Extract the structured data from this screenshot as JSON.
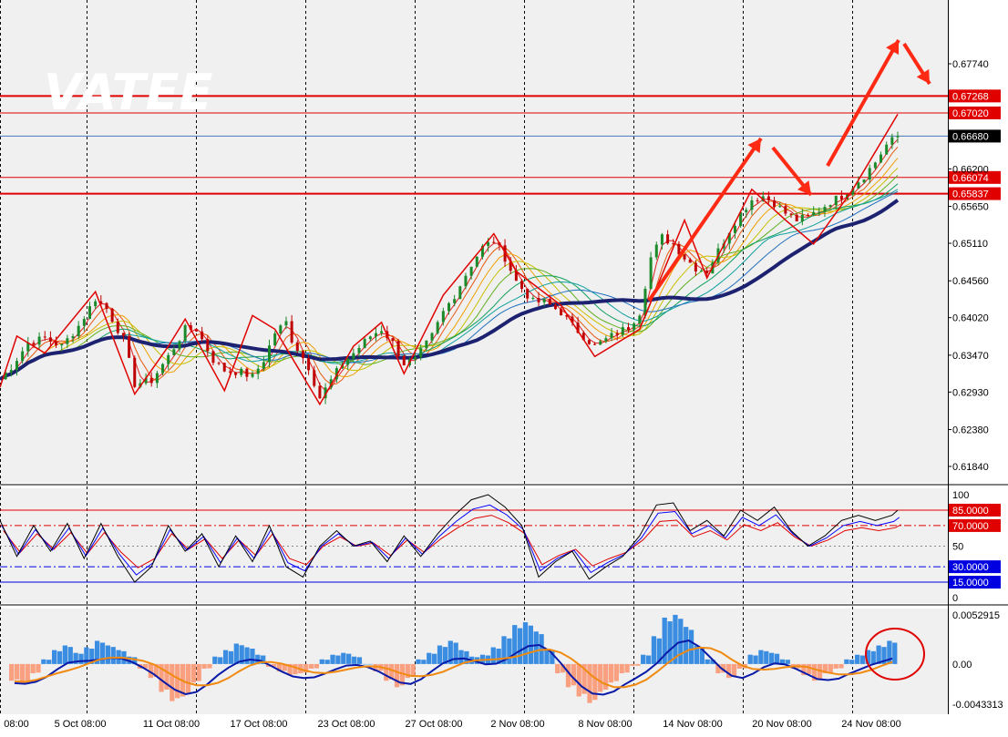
{
  "watermark": "VATEE",
  "colors": {
    "background": "#ffffff",
    "panel": "#f0f0f0",
    "grid": "#000000",
    "bull_candle": "#1a8a2a",
    "bear_candle": "#c00000",
    "level_line": "#e00000",
    "current_line": "#4a7ab8",
    "ma_slow": "#1c2270",
    "zigzag": "#e00000",
    "arrow": "#ff2a14",
    "stoch_k": "#000000",
    "stoch_d": "#0000ff",
    "stoch_slow": "#e00000",
    "macd_pos": "#3a8de0",
    "macd_neg": "#f8a080",
    "macd_line": "#0a1aa8",
    "signal_line": "#f08a10",
    "highlight_circle": "#e00000"
  },
  "time_axis": {
    "labels": [
      "08:00",
      "5 Oct 08:00",
      "11 Oct 08:00",
      "17 Oct 08:00",
      "23 Oct 08:00",
      "27 Oct 08:00",
      "2 Nov 08:00",
      "8 Nov 08:00",
      "14 Nov 08:00",
      "20 Nov 08:00",
      "24 Nov 08:00"
    ]
  },
  "price_axis": {
    "ticks": [
      "0.67740",
      "0.66200",
      "0.65650",
      "0.65110",
      "0.64560",
      "0.64020",
      "0.63470",
      "0.62930",
      "0.62380",
      "0.61840"
    ],
    "levels": [
      {
        "label": "0.67268",
        "value": 0.67268,
        "style": "red-tag"
      },
      {
        "label": "0.67020",
        "value": 0.6702,
        "style": "red-tag"
      },
      {
        "label": "0.66680",
        "value": 0.6668,
        "style": "current"
      },
      {
        "label": "0.66074",
        "value": 0.66074,
        "style": "red-tag"
      },
      {
        "label": "0.65837",
        "value": 0.65837,
        "style": "red-tag"
      }
    ]
  },
  "oscillator_axis": {
    "ticks": [
      "100",
      "50",
      "0"
    ],
    "levels": [
      {
        "label": "85.0000",
        "value": 85,
        "color": "#e00000",
        "tag_text": "#ffffff"
      },
      {
        "label": "70.0000",
        "value": 70,
        "color": "#e00000",
        "tag_text": "#ffffff"
      },
      {
        "label": "30.0000",
        "value": 30,
        "color": "#0000e0",
        "tag_text": "#ffffff"
      },
      {
        "label": "15.0000",
        "value": 15,
        "color": "#0000e0",
        "tag_text": "#ffffff"
      }
    ]
  },
  "macd_axis": {
    "ticks": [
      "0.0052915",
      "0.00",
      "-0.0043313"
    ]
  },
  "chart_data": [
    {
      "type": "candlestick",
      "title": "",
      "x": [
        "08:00",
        "5 Oct 08:00",
        "11 Oct 08:00",
        "17 Oct 08:00",
        "23 Oct 08:00",
        "27 Oct 08:00",
        "2 Nov 08:00",
        "8 Nov 08:00",
        "14 Nov 08:00",
        "20 Nov 08:00",
        "24 Nov 08:00"
      ],
      "close_path": [
        [
          0,
          0.6312
        ],
        [
          2,
          0.633
        ],
        [
          5,
          0.6365
        ],
        [
          8,
          0.6372
        ],
        [
          11,
          0.636
        ],
        [
          14,
          0.639
        ],
        [
          17,
          0.643
        ],
        [
          19,
          0.6415
        ],
        [
          22,
          0.637
        ],
        [
          24,
          0.6305
        ],
        [
          27,
          0.631
        ],
        [
          30,
          0.6345
        ],
        [
          33,
          0.6385
        ],
        [
          35,
          0.6385
        ],
        [
          38,
          0.634
        ],
        [
          40,
          0.6325
        ],
        [
          43,
          0.6322
        ],
        [
          45,
          0.6315
        ],
        [
          47,
          0.634
        ],
        [
          49,
          0.638
        ],
        [
          51,
          0.6395
        ],
        [
          52,
          0.637
        ],
        [
          55,
          0.633
        ],
        [
          57,
          0.6285
        ],
        [
          59,
          0.631
        ],
        [
          61,
          0.6335
        ],
        [
          63,
          0.635
        ],
        [
          66,
          0.6375
        ],
        [
          68,
          0.6385
        ],
        [
          70,
          0.6365
        ],
        [
          72,
          0.6335
        ],
        [
          74,
          0.634
        ],
        [
          77,
          0.6375
        ],
        [
          79,
          0.641
        ],
        [
          81,
          0.6435
        ],
        [
          84,
          0.648
        ],
        [
          86,
          0.6505
        ],
        [
          88,
          0.6515
        ],
        [
          90,
          0.649
        ],
        [
          92,
          0.6455
        ],
        [
          95,
          0.6425
        ],
        [
          97,
          0.6425
        ],
        [
          100,
          0.641
        ],
        [
          102,
          0.639
        ],
        [
          104,
          0.6375
        ],
        [
          106,
          0.636
        ],
        [
          108,
          0.637
        ],
        [
          110,
          0.638
        ],
        [
          112,
          0.6388
        ],
        [
          114,
          0.641
        ],
        [
          116,
          0.649
        ],
        [
          118,
          0.652
        ],
        [
          120,
          0.651
        ],
        [
          122,
          0.649
        ],
        [
          124,
          0.6475
        ],
        [
          126,
          0.647
        ],
        [
          128,
          0.65
        ],
        [
          130,
          0.653
        ],
        [
          132,
          0.6555
        ],
        [
          134,
          0.6575
        ],
        [
          136,
          0.658
        ],
        [
          138,
          0.657
        ],
        [
          140,
          0.6555
        ],
        [
          142,
          0.6545
        ],
        [
          144,
          0.655
        ],
        [
          146,
          0.656
        ],
        [
          148,
          0.6572
        ],
        [
          150,
          0.658
        ],
        [
          152,
          0.6595
        ],
        [
          154,
          0.661
        ],
        [
          156,
          0.663
        ],
        [
          158,
          0.6655
        ],
        [
          160,
          0.6668
        ]
      ],
      "overbought_level": 85,
      "oversold_level": 15
    },
    {
      "type": "line",
      "title": "",
      "series": [
        {
          "values": [
            [
              0,
              75
            ],
            [
              3,
              40
            ],
            [
              6,
              70
            ],
            [
              9,
              45
            ],
            [
              12,
              72
            ],
            [
              15,
              38
            ],
            [
              18,
              72
            ],
            [
              21,
              40
            ],
            [
              24,
              15
            ],
            [
              27,
              30
            ],
            [
              30,
              70
            ],
            [
              33,
              45
            ],
            [
              36,
              62
            ],
            [
              39,
              30
            ],
            [
              42,
              60
            ],
            [
              45,
              35
            ],
            [
              48,
              70
            ],
            [
              51,
              30
            ],
            [
              54,
              20
            ],
            [
              57,
              50
            ],
            [
              60,
              65
            ],
            [
              63,
              50
            ],
            [
              66,
              55
            ],
            [
              69,
              35
            ],
            [
              72,
              60
            ],
            [
              75,
              40
            ],
            [
              78,
              62
            ],
            [
              81,
              80
            ],
            [
              84,
              95
            ],
            [
              87,
              100
            ],
            [
              90,
              88
            ],
            [
              93,
              70
            ],
            [
              96,
              20
            ],
            [
              99,
              35
            ],
            [
              102,
              45
            ],
            [
              105,
              18
            ],
            [
              108,
              30
            ],
            [
              111,
              40
            ],
            [
              114,
              60
            ],
            [
              117,
              90
            ],
            [
              120,
              92
            ],
            [
              123,
              65
            ],
            [
              126,
              75
            ],
            [
              129,
              60
            ],
            [
              132,
              85
            ],
            [
              135,
              75
            ],
            [
              138,
              88
            ],
            [
              141,
              65
            ],
            [
              144,
              50
            ],
            [
              147,
              60
            ],
            [
              150,
              75
            ],
            [
              153,
              80
            ],
            [
              156,
              75
            ],
            [
              159,
              80
            ],
            [
              160,
              85
            ]
          ]
        }
      ]
    },
    {
      "type": "bar",
      "title": "",
      "series": [
        {
          "values": [
            -0.0018,
            -0.002,
            -0.001,
            0.0005,
            0.0015,
            0.002,
            0.0012,
            0.0018,
            0.0025,
            0.002,
            0.0015,
            0.0008,
            -0.0005,
            -0.0015,
            -0.003,
            -0.004,
            -0.0035,
            -0.002,
            -0.0005,
            0.0008,
            0.0015,
            0.0022,
            0.0018,
            0.001,
            -0.0003,
            -0.0008,
            -0.0012,
            -0.001,
            -0.0005,
            0.0005,
            0.001,
            0.0012,
            0.0008,
            0.0,
            -0.0008,
            -0.0018,
            -0.0025,
            -0.0015,
            0.0005,
            0.0012,
            0.002,
            0.0025,
            0.0015,
            0.0008,
            0.001,
            0.0018,
            0.003,
            0.0042,
            0.0045,
            0.0035,
            0.0015,
            -0.001,
            -0.0025,
            -0.0035,
            -0.0042,
            -0.003,
            -0.002,
            -0.001,
            -0.0002,
            0.001,
            0.003,
            0.005,
            0.0053,
            0.004,
            0.002,
            0.0005,
            -0.001,
            -0.0015,
            -0.0005,
            0.001,
            0.0015,
            0.0012,
            0.0005,
            -0.0005,
            -0.0012,
            -0.0018,
            -0.001,
            -0.0005,
            0.0005,
            0.001,
            0.0015,
            0.002,
            0.0025
          ]
        }
      ]
    }
  ]
}
